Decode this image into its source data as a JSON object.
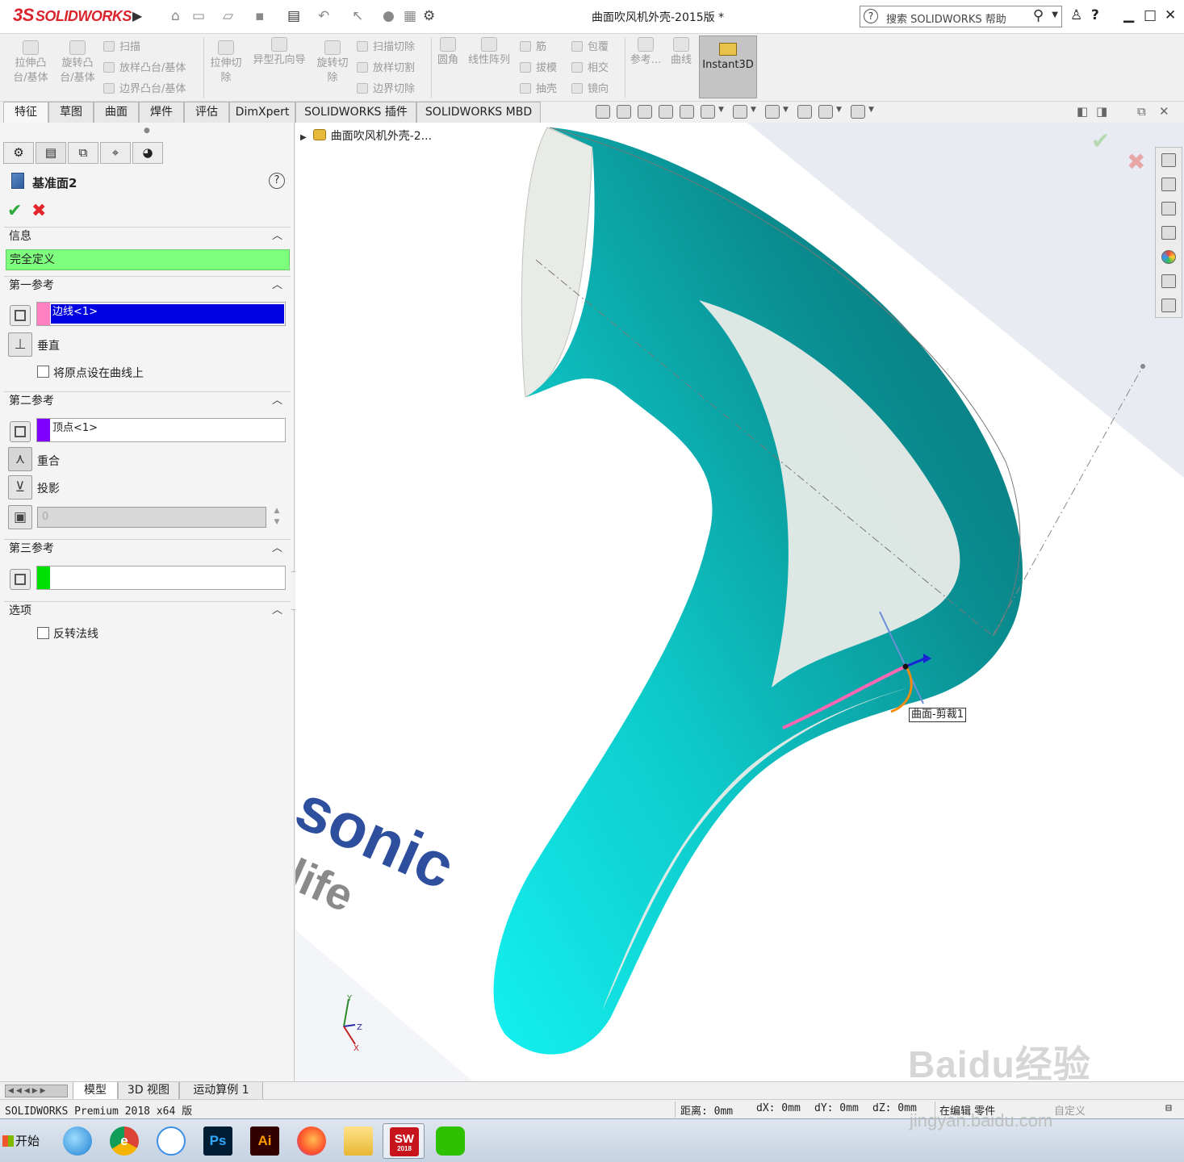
{
  "app": {
    "logo_ds": "3S",
    "logo_text": "SOLIDWORKS",
    "document_title": "曲面吹风机外壳-2015版 *",
    "search_placeholder": "搜索 SOLIDWORKS 帮助"
  },
  "command_manager": {
    "extrude_boss": "拉伸凸\n台/基体",
    "revolve_boss": "旋转凸\n台/基体",
    "sweep": "扫描",
    "loft": "放样凸台/基体",
    "boundary": "边界凸台/基体",
    "extrude_cut": "拉伸切\n除",
    "hole_wizard": "异型孔向导",
    "revolve_cut": "旋转切\n除",
    "swept_cut": "扫描切除",
    "lofted_cut": "放样切割",
    "boundary_cut": "边界切除",
    "fillet": "圆角",
    "linear_pattern": "线性阵列",
    "rib": "筋",
    "draft": "拔模",
    "shell": "抽壳",
    "wrap": "包覆",
    "intersect": "相交",
    "mirror": "镜向",
    "reference": "参考...",
    "curves": "曲线",
    "instant3d": "Instant3D"
  },
  "tabs": [
    "特征",
    "草图",
    "曲面",
    "焊件",
    "评估",
    "DimXpert",
    "SOLIDWORKS 插件",
    "SOLIDWORKS MBD"
  ],
  "property_manager": {
    "title": "基准面2",
    "sections": {
      "info": "信息",
      "status": "完全定义",
      "first_ref": "第一参考",
      "second_ref": "第二参考",
      "third_ref": "第三参考",
      "options": "选项"
    },
    "first_ref_value": "边线<1>",
    "first_ref_constraint": "垂直",
    "origin_on_curve": "将原点设在曲线上",
    "second_ref_value": "顶点<1>",
    "coincident": "重合",
    "projection": "投影",
    "distance_value": "0",
    "flip_normal": "反转法线",
    "colors": {
      "first_swatch": "#ff80c0",
      "second_swatch": "#8000ff",
      "third_swatch": "#00e000",
      "selected_bg": "#0000e0"
    }
  },
  "viewport": {
    "tree_item": "曲面吹风机外壳-2...",
    "callout": "曲面-剪裁1",
    "background_text_1": "sonic",
    "background_text_2": "life",
    "triad": {
      "x": "X",
      "y": "Y",
      "z": "Z"
    }
  },
  "bottom_tabs": [
    "模型",
    "3D 视图",
    "运动算例 1"
  ],
  "status_bar": {
    "product": "SOLIDWORKS Premium 2018 x64 版",
    "distance": "距离: 0mm",
    "dx": "dX: 0mm",
    "dy": "dY: 0mm",
    "dz": "dZ: 0mm",
    "mode": "在编辑 零件",
    "units": "自定义"
  },
  "taskbar": {
    "start": "开始",
    "apps": [
      "browser-icon",
      "chrome-icon",
      "baidu-cloud-icon",
      "photoshop-icon",
      "illustrator-icon",
      "firefox-icon",
      "explorer-icon",
      "solidworks-icon",
      "wechat-icon"
    ],
    "ps_label": "Ps",
    "ai_label": "Ai",
    "sw_label": "SW",
    "sw_year": "2018"
  },
  "watermark": {
    "brand": "Baidu经验",
    "url": "jingyan.baidu.com"
  },
  "model_colors": {
    "shell_dark": "#0a6f74",
    "shell_mid": "#0aa6a8",
    "shell_light": "#14f0f0",
    "inner": "#e9ebe7"
  }
}
